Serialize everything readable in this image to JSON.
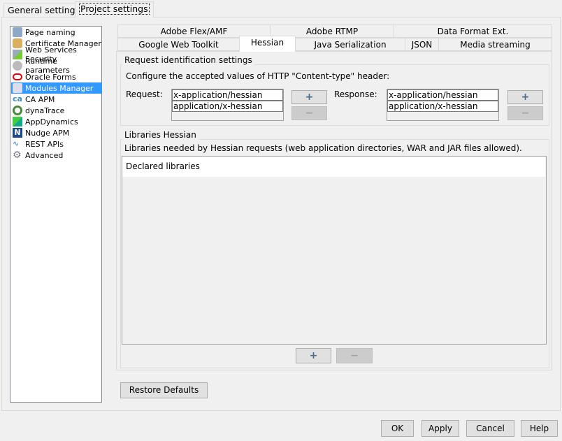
{
  "top_tabs": [
    "General settings",
    "Project settings"
  ],
  "sidebar": {
    "items": [
      {
        "label": "Page naming",
        "icon": "page-naming-icon"
      },
      {
        "label": "Certificate Manager",
        "icon": "lock-icon"
      },
      {
        "label": "Web Services Security",
        "icon": "ws-security-icon"
      },
      {
        "label": "Runtime parameters",
        "icon": "gears-icon"
      },
      {
        "label": "Oracle Forms",
        "icon": "oracle-icon"
      },
      {
        "label": "Modules Manager",
        "icon": "module-icon",
        "selected": true
      },
      {
        "label": "CA APM",
        "icon": "ca-icon"
      },
      {
        "label": "dynaTrace",
        "icon": "dynatrace-icon"
      },
      {
        "label": "AppDynamics",
        "icon": "appdynamics-icon"
      },
      {
        "label": "Nudge APM",
        "icon": "nudge-icon"
      },
      {
        "label": "REST APIs",
        "icon": "rest-icon"
      },
      {
        "label": "Advanced",
        "icon": "gear-icon"
      }
    ]
  },
  "module_tabs": {
    "row1": [
      "Adobe Flex/AMF",
      "Adobe RTMP",
      "Data Format Ext."
    ],
    "row2": [
      "Google Web Toolkit",
      "Hessian",
      "Java Serialization",
      "JSON",
      "Media streaming"
    ],
    "selected": "Hessian"
  },
  "request_group": {
    "title": "Request identification settings",
    "description": "Configure the accepted values of HTTP \"Content-type\" header:",
    "request_label": "Request:",
    "request_values": [
      "x-application/hessian",
      "application/x-hessian"
    ],
    "response_label": "Response:",
    "response_values": [
      "x-application/hessian",
      "application/x-hessian"
    ],
    "add": "+",
    "remove": "−"
  },
  "libraries_group": {
    "title": "Libraries Hessian",
    "description": "Libraries needed by Hessian requests (web application directories, WAR and JAR files allowed).",
    "column_header": "Declared libraries",
    "add": "+",
    "remove": "−"
  },
  "restore_defaults": "Restore Defaults",
  "footer": {
    "ok": "OK",
    "apply": "Apply",
    "cancel": "Cancel",
    "help": "Help"
  }
}
